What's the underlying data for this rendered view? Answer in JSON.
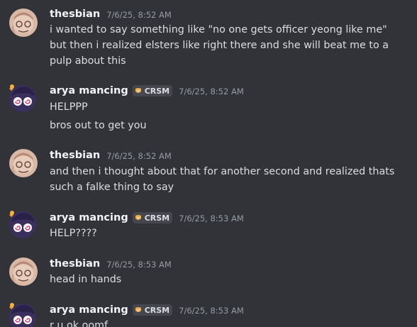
{
  "messages": [
    {
      "author": "thesbian",
      "timestamp": "7/6/25, 8:52 AM",
      "lines": [
        "i wanted to say something like \"no one gets officer yeong like me\" but then i realized elsters like right there and she will beat me to a pulp about this"
      ]
    },
    {
      "author": "arya mancing",
      "tag": "CRSM",
      "timestamp": "7/6/25, 8:52 AM",
      "lines": [
        "HELPPP",
        "bros out to get you"
      ]
    },
    {
      "author": "thesbian",
      "timestamp": "7/6/25, 8:52 AM",
      "lines": [
        "and then i thought about that for another second and realized thats such a falke thing to say"
      ]
    },
    {
      "author": "arya mancing",
      "tag": "CRSM",
      "timestamp": "7/6/25, 8:53 AM",
      "lines": [
        "HELP????"
      ]
    },
    {
      "author": "thesbian",
      "timestamp": "7/6/25, 8:53 AM",
      "lines": [
        "head in hands"
      ]
    },
    {
      "author": "arya mancing",
      "tag": "CRSM",
      "timestamp": "7/6/25, 8:53 AM",
      "lines": [
        "r u ok oomf"
      ]
    }
  ],
  "icons": {
    "thesbian_avatar": "avatar-thesbian-icon",
    "arya_avatar": "avatar-arya-icon",
    "tag_icon": "guild-tag-icon"
  },
  "colors": {
    "background": "#323339",
    "username": "#f2f3f5",
    "timestamp": "#949ba4",
    "text": "#dbdee1",
    "tag_bg": "#45464e"
  }
}
